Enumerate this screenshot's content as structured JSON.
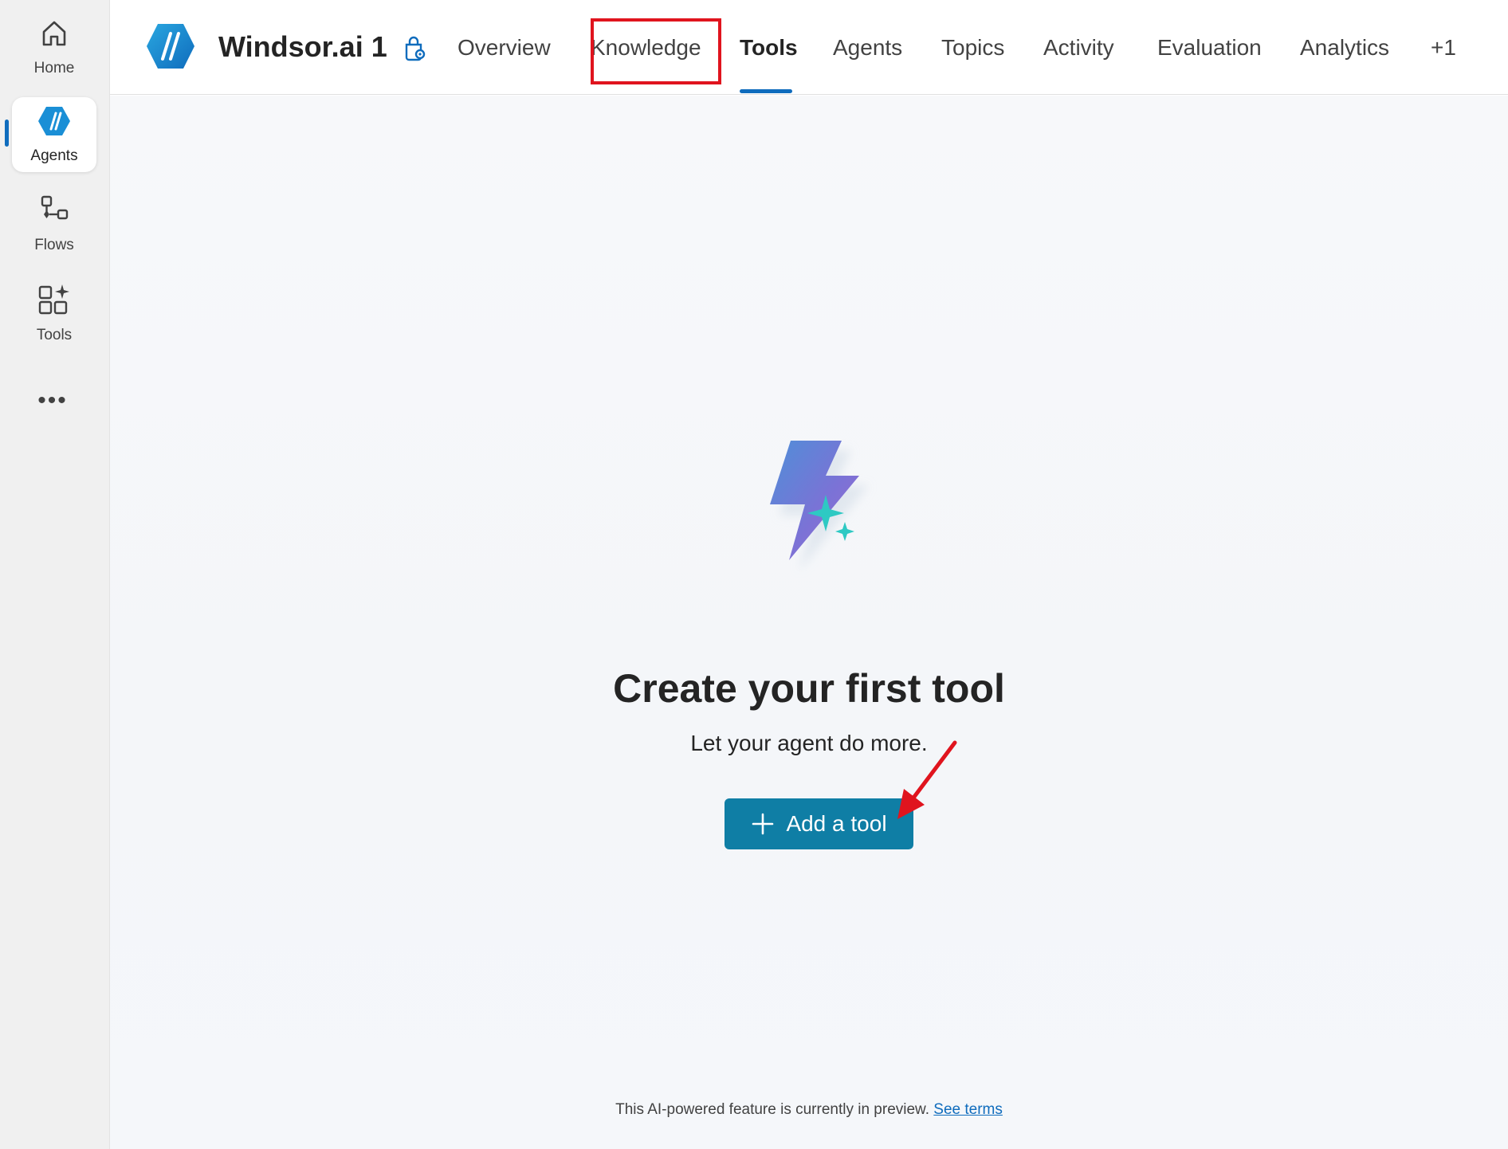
{
  "rail": {
    "items": [
      {
        "label": "Home",
        "icon": "home-icon"
      },
      {
        "label": "Agents",
        "icon": "agents-icon",
        "active": true
      },
      {
        "label": "Flows",
        "icon": "flows-icon"
      },
      {
        "label": "Tools",
        "icon": "tools-icon"
      }
    ],
    "more": "•••"
  },
  "header": {
    "agent_name": "Windsor.ai 1",
    "tabs": [
      {
        "label": "Overview"
      },
      {
        "label": "Knowledge"
      },
      {
        "label": "Tools",
        "active": true
      },
      {
        "label": "Agents"
      },
      {
        "label": "Topics"
      },
      {
        "label": "Activity"
      },
      {
        "label": "Evaluation"
      },
      {
        "label": "Analytics"
      },
      {
        "label": "+1"
      }
    ]
  },
  "main": {
    "title": "Create your first tool",
    "subtitle": "Let your agent do more.",
    "add_button": "Add a tool",
    "footer_text": "This AI-powered feature is currently in preview.",
    "footer_link": "See terms"
  },
  "colors": {
    "accent": "#0f6cbd",
    "button": "#0f7ea5",
    "highlight": "#e0141e"
  }
}
